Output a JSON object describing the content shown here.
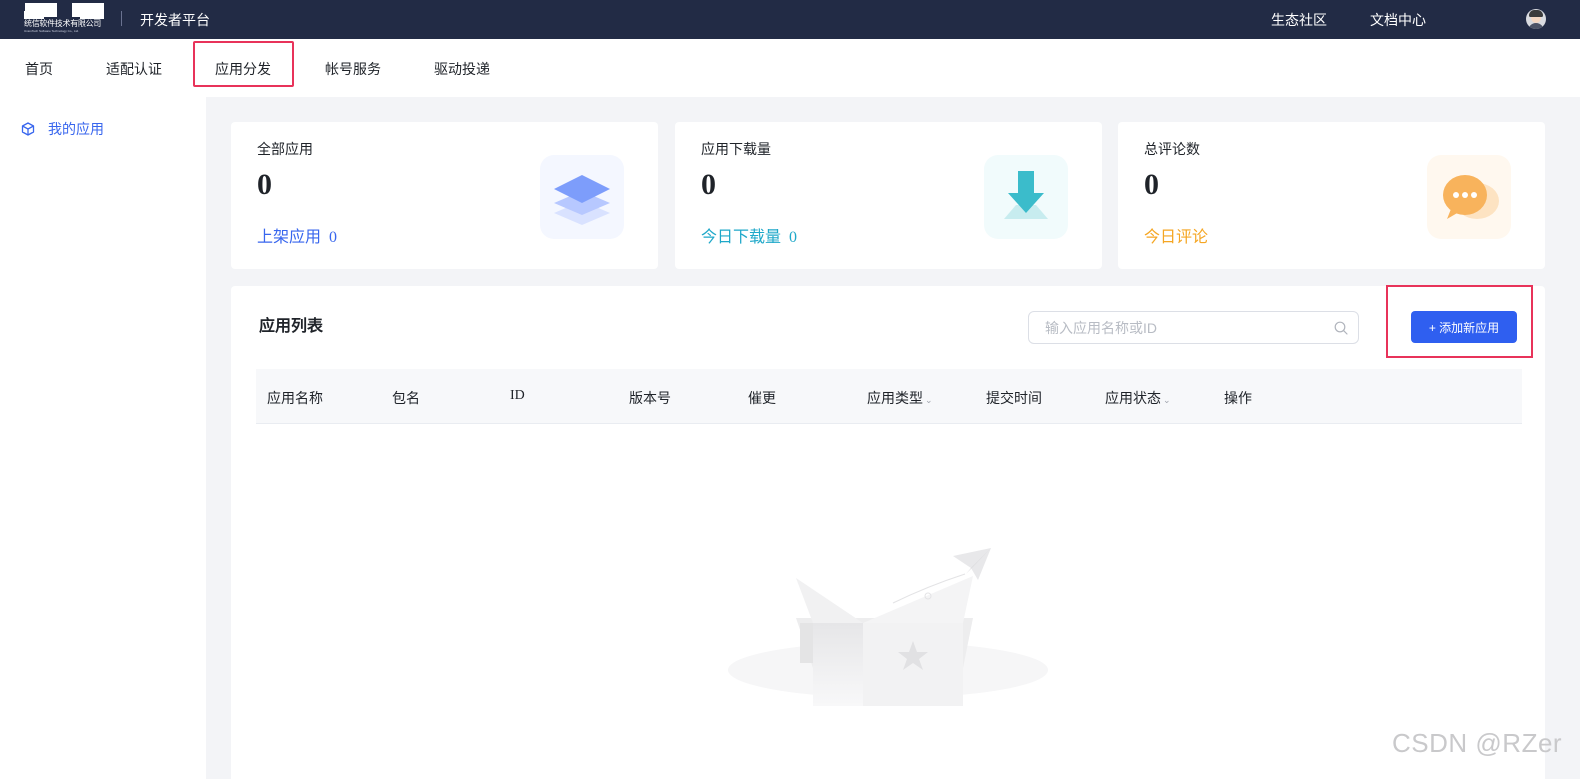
{
  "topbar": {
    "logo_text_cn": "统信软件技术有限公司",
    "logo_text_en": "UnionTech Software Technology Co., Ltd.",
    "platform_title": "开发者平台",
    "links": [
      "生态社区",
      "文档中心"
    ]
  },
  "nav": {
    "items": [
      "首页",
      "适配认证",
      "应用分发",
      "帐号服务",
      "驱动投递"
    ],
    "active_index": 2
  },
  "sidebar": {
    "items": [
      {
        "label": "我的应用",
        "icon": "cube-icon"
      }
    ]
  },
  "stats": [
    {
      "title": "全部应用",
      "value": "0",
      "sub_label": "上架应用",
      "sub_value": "0",
      "sub_color": "#3866ee",
      "icon": "layers-icon"
    },
    {
      "title": "应用下载量",
      "value": "0",
      "sub_label": "今日下载量",
      "sub_value": "0",
      "sub_color": "#1fa8c9",
      "icon": "download-icon"
    },
    {
      "title": "总评论数",
      "value": "0",
      "sub_label": "今日评论",
      "sub_value": "",
      "sub_color": "#f5a623",
      "icon": "chat-icon"
    }
  ],
  "app_list": {
    "title": "应用列表",
    "search_placeholder": "输入应用名称或ID",
    "add_button": "+ 添加新应用",
    "columns": [
      "应用名称",
      "包名",
      "ID",
      "版本号",
      "催更",
      "应用类型",
      "提交时间",
      "应用状态",
      "操作"
    ],
    "rows": []
  },
  "watermark": "CSDN @RZer",
  "colors": {
    "topbar_bg": "#222b45",
    "accent": "#2f5ff0",
    "highlight": "#e8335a"
  }
}
